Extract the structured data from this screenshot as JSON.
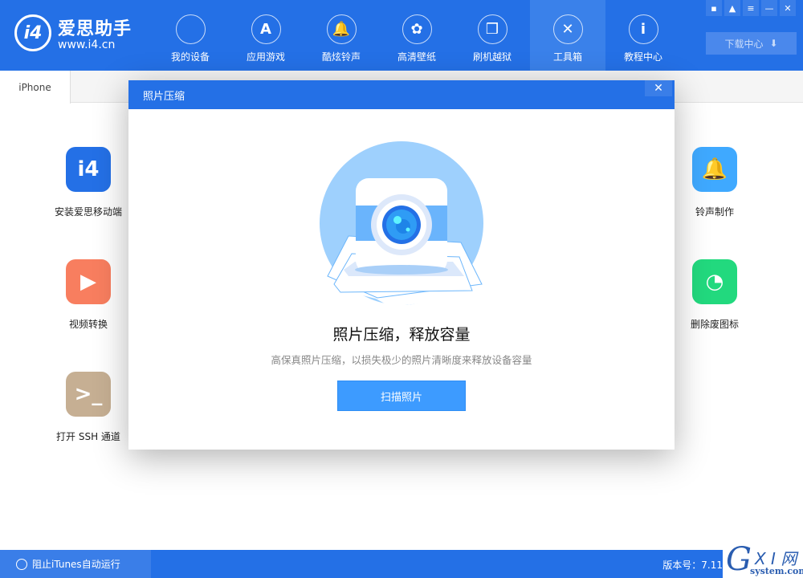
{
  "header": {
    "logo_mark": "i4",
    "logo_name": "爱思助手",
    "logo_url": "www.i4.cn",
    "nav": [
      {
        "label": "我的设备",
        "icon": "apple-icon",
        "glyph": ""
      },
      {
        "label": "应用游戏",
        "icon": "app-store-icon",
        "glyph": "A"
      },
      {
        "label": "酷炫铃声",
        "icon": "bell-icon",
        "glyph": "🔔"
      },
      {
        "label": "高清壁纸",
        "icon": "flower-icon",
        "glyph": "✿"
      },
      {
        "label": "刷机越狱",
        "icon": "box-icon",
        "glyph": "❒"
      },
      {
        "label": "工具箱",
        "icon": "tools-icon",
        "glyph": "✕"
      },
      {
        "label": "教程中心",
        "icon": "info-icon",
        "glyph": "i"
      }
    ],
    "active_nav": "工具箱",
    "window_controls": [
      {
        "icon": "feedback-icon",
        "glyph": "▪"
      },
      {
        "icon": "skin-icon",
        "glyph": "▲"
      },
      {
        "icon": "menu-icon",
        "glyph": "≡"
      },
      {
        "icon": "minimize-icon",
        "glyph": "—"
      },
      {
        "icon": "close-icon",
        "glyph": "✕"
      }
    ],
    "download_label": "下载中心",
    "download_glyph": "⬇"
  },
  "tabs": [
    {
      "label": "iPhone"
    }
  ],
  "apps_left": [
    {
      "label": "安装爱思移动端",
      "icon": "i4-icon",
      "color": "#2470e6",
      "glyph": "i4"
    },
    {
      "label": "视频转换",
      "icon": "video-convert-icon",
      "color": "#f87e5f",
      "glyph": "▶"
    },
    {
      "label": "打开 SSH 通道",
      "icon": "ssh-terminal-icon",
      "color": "#c6af93",
      "glyph": ">_"
    }
  ],
  "apps_right": [
    {
      "label": "铃声制作",
      "icon": "bell-plus-icon",
      "color": "#3fa9ff",
      "glyph": "🔔"
    },
    {
      "label": "删除废图标",
      "icon": "pie-timer-icon",
      "color": "#22d97e",
      "glyph": "◔"
    }
  ],
  "modal": {
    "title": "照片压缩",
    "close_glyph": "✕",
    "heading": "照片压缩，释放容量",
    "subtitle": "高保真照片压缩，以损失极少的照片清晰度来释放设备容量",
    "scan_button": "扫描照片"
  },
  "footer": {
    "itunes_label": "阻止iTunes自动运行",
    "version": "版本号：7.11"
  },
  "watermark": {
    "text": "GXI网 system.com"
  }
}
